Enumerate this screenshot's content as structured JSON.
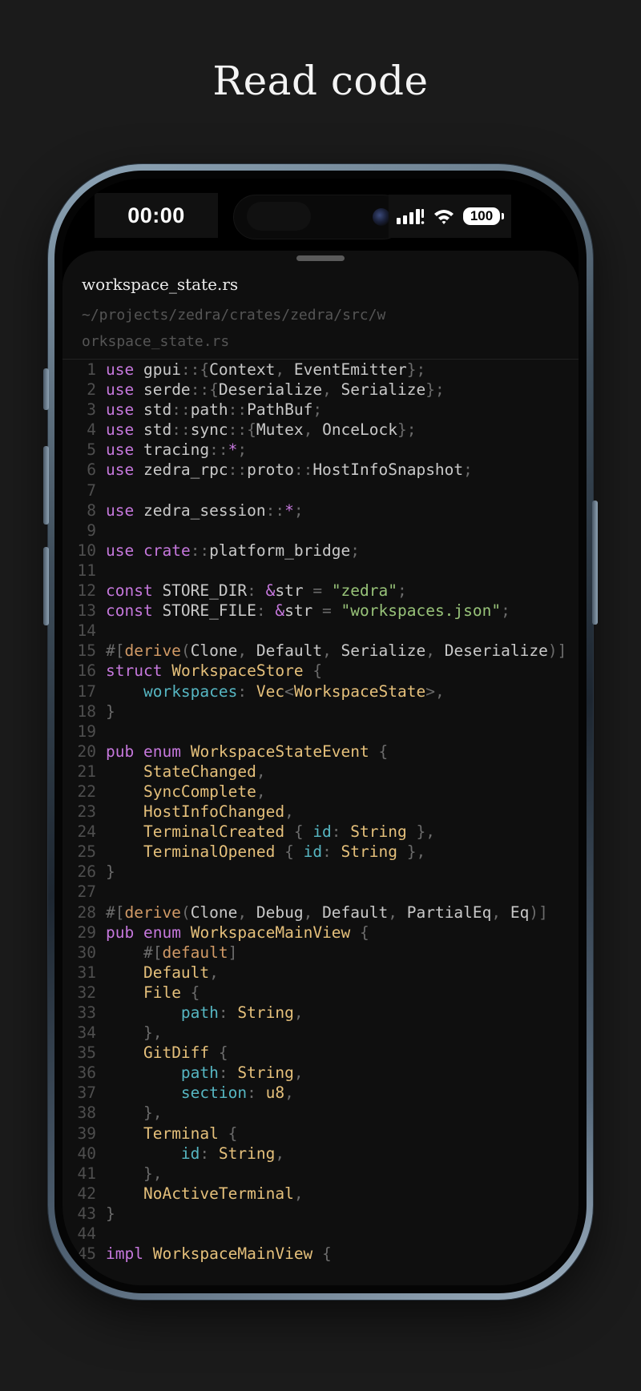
{
  "headline": "Read code",
  "status_bar": {
    "time": "00:00",
    "battery": "100",
    "icons": [
      "signal-icon",
      "wifi-icon",
      "battery-icon"
    ]
  },
  "file": {
    "name": "workspace_state.rs",
    "path": "~/projects/zedra/crates/zedra/src/workspace_state.rs"
  },
  "colors": {
    "background": "#1b1b1b",
    "keyword": "#c678dd",
    "type": "#e5c07b",
    "string": "#98c379",
    "field": "#56b6c2",
    "macro": "#d19a66",
    "line_number": "#4e4e4e"
  },
  "code_lines": [
    {
      "n": "1",
      "tokens": [
        [
          "k",
          "use"
        ],
        [
          "n",
          " gpui"
        ],
        [
          "p",
          "::{"
        ],
        [
          "n",
          "Context"
        ],
        [
          "p",
          ", "
        ],
        [
          "n",
          "EventEmitter"
        ],
        [
          "p",
          "};"
        ]
      ]
    },
    {
      "n": "2",
      "tokens": [
        [
          "k",
          "use"
        ],
        [
          "n",
          " serde"
        ],
        [
          "p",
          "::{"
        ],
        [
          "n",
          "Deserialize"
        ],
        [
          "p",
          ", "
        ],
        [
          "n",
          "Serialize"
        ],
        [
          "p",
          "};"
        ]
      ]
    },
    {
      "n": "3",
      "tokens": [
        [
          "k",
          "use"
        ],
        [
          "n",
          " std"
        ],
        [
          "p",
          "::"
        ],
        [
          "n",
          "path"
        ],
        [
          "p",
          "::"
        ],
        [
          "n",
          "PathBuf"
        ],
        [
          "p",
          ";"
        ]
      ]
    },
    {
      "n": "4",
      "tokens": [
        [
          "k",
          "use"
        ],
        [
          "n",
          " std"
        ],
        [
          "p",
          "::"
        ],
        [
          "n",
          "sync"
        ],
        [
          "p",
          "::{"
        ],
        [
          "n",
          "Mutex"
        ],
        [
          "p",
          ", "
        ],
        [
          "n",
          "OnceLock"
        ],
        [
          "p",
          "};"
        ]
      ]
    },
    {
      "n": "5",
      "tokens": [
        [
          "k",
          "use"
        ],
        [
          "n",
          " tracing"
        ],
        [
          "p",
          "::"
        ],
        [
          "k",
          "*"
        ],
        [
          "p",
          ";"
        ]
      ]
    },
    {
      "n": "6",
      "tokens": [
        [
          "k",
          "use"
        ],
        [
          "n",
          " zedra_rpc"
        ],
        [
          "p",
          "::"
        ],
        [
          "n",
          "proto"
        ],
        [
          "p",
          "::"
        ],
        [
          "n",
          "HostInfoSnapshot"
        ],
        [
          "p",
          ";"
        ]
      ]
    },
    {
      "n": "7",
      "tokens": []
    },
    {
      "n": "8",
      "tokens": [
        [
          "k",
          "use"
        ],
        [
          "n",
          " zedra_session"
        ],
        [
          "p",
          "::"
        ],
        [
          "k",
          "*"
        ],
        [
          "p",
          ";"
        ]
      ]
    },
    {
      "n": "9",
      "tokens": []
    },
    {
      "n": "10",
      "tokens": [
        [
          "k",
          "use"
        ],
        [
          "n",
          " "
        ],
        [
          "k",
          "crate"
        ],
        [
          "p",
          "::"
        ],
        [
          "n",
          "platform_bridge"
        ],
        [
          "p",
          ";"
        ]
      ]
    },
    {
      "n": "11",
      "tokens": []
    },
    {
      "n": "12",
      "tokens": [
        [
          "k",
          "const"
        ],
        [
          "n",
          " STORE_DIR"
        ],
        [
          "p",
          ": "
        ],
        [
          "k",
          "&"
        ],
        [
          "n",
          "str"
        ],
        [
          "p",
          " = "
        ],
        [
          "s",
          "\"zedra\""
        ],
        [
          "p",
          ";"
        ]
      ]
    },
    {
      "n": "13",
      "tokens": [
        [
          "k",
          "const"
        ],
        [
          "n",
          " STORE_FILE"
        ],
        [
          "p",
          ": "
        ],
        [
          "k",
          "&"
        ],
        [
          "n",
          "str"
        ],
        [
          "p",
          " = "
        ],
        [
          "s",
          "\"workspaces.json\""
        ],
        [
          "p",
          ";"
        ]
      ]
    },
    {
      "n": "14",
      "tokens": []
    },
    {
      "n": "15",
      "tokens": [
        [
          "p",
          "#["
        ],
        [
          "m",
          "derive"
        ],
        [
          "p",
          "("
        ],
        [
          "n",
          "Clone"
        ],
        [
          "p",
          ", "
        ],
        [
          "n",
          "Default"
        ],
        [
          "p",
          ", "
        ],
        [
          "n",
          "Serialize"
        ],
        [
          "p",
          ", "
        ],
        [
          "n",
          "Deserialize"
        ],
        [
          "p",
          ")]"
        ]
      ]
    },
    {
      "n": "16",
      "tokens": [
        [
          "k",
          "struct"
        ],
        [
          "n",
          " "
        ],
        [
          "t",
          "WorkspaceStore"
        ],
        [
          "p",
          " {"
        ]
      ]
    },
    {
      "n": "17",
      "tokens": [
        [
          "n",
          "    "
        ],
        [
          "f",
          "workspaces"
        ],
        [
          "p",
          ": "
        ],
        [
          "t",
          "Vec"
        ],
        [
          "p",
          "<"
        ],
        [
          "t",
          "WorkspaceState"
        ],
        [
          "p",
          ">,"
        ]
      ]
    },
    {
      "n": "18",
      "tokens": [
        [
          "p",
          "}"
        ]
      ]
    },
    {
      "n": "19",
      "tokens": []
    },
    {
      "n": "20",
      "tokens": [
        [
          "k",
          "pub"
        ],
        [
          "n",
          " "
        ],
        [
          "k",
          "enum"
        ],
        [
          "n",
          " "
        ],
        [
          "t",
          "WorkspaceStateEvent"
        ],
        [
          "p",
          " {"
        ]
      ]
    },
    {
      "n": "21",
      "tokens": [
        [
          "n",
          "    "
        ],
        [
          "t",
          "StateChanged"
        ],
        [
          "p",
          ","
        ]
      ]
    },
    {
      "n": "22",
      "tokens": [
        [
          "n",
          "    "
        ],
        [
          "t",
          "SyncComplete"
        ],
        [
          "p",
          ","
        ]
      ]
    },
    {
      "n": "23",
      "tokens": [
        [
          "n",
          "    "
        ],
        [
          "t",
          "HostInfoChanged"
        ],
        [
          "p",
          ","
        ]
      ]
    },
    {
      "n": "24",
      "tokens": [
        [
          "n",
          "    "
        ],
        [
          "t",
          "TerminalCreated"
        ],
        [
          "p",
          " { "
        ],
        [
          "f",
          "id"
        ],
        [
          "p",
          ": "
        ],
        [
          "t",
          "String"
        ],
        [
          "p",
          " },"
        ]
      ]
    },
    {
      "n": "25",
      "tokens": [
        [
          "n",
          "    "
        ],
        [
          "t",
          "TerminalOpened"
        ],
        [
          "p",
          " { "
        ],
        [
          "f",
          "id"
        ],
        [
          "p",
          ": "
        ],
        [
          "t",
          "String"
        ],
        [
          "p",
          " },"
        ]
      ]
    },
    {
      "n": "26",
      "tokens": [
        [
          "p",
          "}"
        ]
      ]
    },
    {
      "n": "27",
      "tokens": []
    },
    {
      "n": "28",
      "tokens": [
        [
          "p",
          "#["
        ],
        [
          "m",
          "derive"
        ],
        [
          "p",
          "("
        ],
        [
          "n",
          "Clone"
        ],
        [
          "p",
          ", "
        ],
        [
          "n",
          "Debug"
        ],
        [
          "p",
          ", "
        ],
        [
          "n",
          "Default"
        ],
        [
          "p",
          ", "
        ],
        [
          "n",
          "PartialEq"
        ],
        [
          "p",
          ", "
        ],
        [
          "n",
          "Eq"
        ],
        [
          "p",
          ")]"
        ]
      ]
    },
    {
      "n": "29",
      "tokens": [
        [
          "k",
          "pub"
        ],
        [
          "n",
          " "
        ],
        [
          "k",
          "enum"
        ],
        [
          "n",
          " "
        ],
        [
          "t",
          "WorkspaceMainView"
        ],
        [
          "p",
          " {"
        ]
      ]
    },
    {
      "n": "30",
      "tokens": [
        [
          "n",
          "    "
        ],
        [
          "p",
          "#["
        ],
        [
          "m",
          "default"
        ],
        [
          "p",
          "]"
        ]
      ]
    },
    {
      "n": "31",
      "tokens": [
        [
          "n",
          "    "
        ],
        [
          "t",
          "Default"
        ],
        [
          "p",
          ","
        ]
      ]
    },
    {
      "n": "32",
      "tokens": [
        [
          "n",
          "    "
        ],
        [
          "t",
          "File"
        ],
        [
          "p",
          " {"
        ]
      ]
    },
    {
      "n": "33",
      "tokens": [
        [
          "n",
          "        "
        ],
        [
          "f",
          "path"
        ],
        [
          "p",
          ": "
        ],
        [
          "t",
          "String"
        ],
        [
          "p",
          ","
        ]
      ]
    },
    {
      "n": "34",
      "tokens": [
        [
          "n",
          "    "
        ],
        [
          "p",
          "},"
        ]
      ]
    },
    {
      "n": "35",
      "tokens": [
        [
          "n",
          "    "
        ],
        [
          "t",
          "GitDiff"
        ],
        [
          "p",
          " {"
        ]
      ]
    },
    {
      "n": "36",
      "tokens": [
        [
          "n",
          "        "
        ],
        [
          "f",
          "path"
        ],
        [
          "p",
          ": "
        ],
        [
          "t",
          "String"
        ],
        [
          "p",
          ","
        ]
      ]
    },
    {
      "n": "37",
      "tokens": [
        [
          "n",
          "        "
        ],
        [
          "f",
          "section"
        ],
        [
          "p",
          ": "
        ],
        [
          "t",
          "u8"
        ],
        [
          "p",
          ","
        ]
      ]
    },
    {
      "n": "38",
      "tokens": [
        [
          "n",
          "    "
        ],
        [
          "p",
          "},"
        ]
      ]
    },
    {
      "n": "39",
      "tokens": [
        [
          "n",
          "    "
        ],
        [
          "t",
          "Terminal"
        ],
        [
          "p",
          " {"
        ]
      ]
    },
    {
      "n": "40",
      "tokens": [
        [
          "n",
          "        "
        ],
        [
          "f",
          "id"
        ],
        [
          "p",
          ": "
        ],
        [
          "t",
          "String"
        ],
        [
          "p",
          ","
        ]
      ]
    },
    {
      "n": "41",
      "tokens": [
        [
          "n",
          "    "
        ],
        [
          "p",
          "},"
        ]
      ]
    },
    {
      "n": "42",
      "tokens": [
        [
          "n",
          "    "
        ],
        [
          "t",
          "NoActiveTerminal"
        ],
        [
          "p",
          ","
        ]
      ]
    },
    {
      "n": "43",
      "tokens": [
        [
          "p",
          "}"
        ]
      ]
    },
    {
      "n": "44",
      "tokens": []
    },
    {
      "n": "45",
      "tokens": [
        [
          "k",
          "impl"
        ],
        [
          "n",
          " "
        ],
        [
          "t",
          "WorkspaceMainView"
        ],
        [
          "p",
          " {"
        ]
      ]
    }
  ]
}
